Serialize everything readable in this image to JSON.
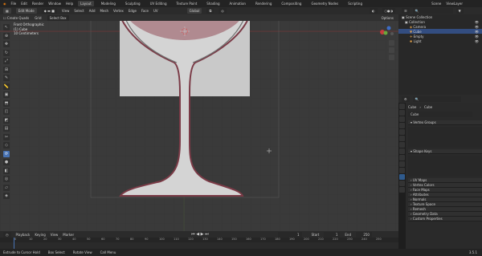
{
  "menu": {
    "items": [
      "File",
      "Edit",
      "Render",
      "Window",
      "Help"
    ]
  },
  "workspaces": [
    "Layout",
    "Modeling",
    "Sculpting",
    "UV Editing",
    "Texture Paint",
    "Shading",
    "Animation",
    "Rendering",
    "Compositing",
    "Geometry Nodes",
    "Scripting"
  ],
  "active_workspace": "Layout",
  "scene_name": "Scene",
  "view_layer": "ViewLayer",
  "viewport_header": {
    "mode": "Edit Mode",
    "menus": [
      "View",
      "Select",
      "Add",
      "Mesh",
      "Vertex",
      "Edge",
      "Face",
      "UV"
    ],
    "transform_orientation": "Global"
  },
  "tool_settings": {
    "create_quads": "Create Quads",
    "grid_fill_label": "Grid",
    "select_box": "Select Box"
  },
  "options_label": "Options",
  "overlay": {
    "view": "Front Orthographic",
    "object": "(1) Cube",
    "scale": "10 Centimeters"
  },
  "timeline": {
    "menus": [
      "Playback",
      "Keying",
      "View",
      "Marker"
    ],
    "ticks": [
      "0",
      "10",
      "20",
      "30",
      "40",
      "50",
      "60",
      "70",
      "80",
      "90",
      "100",
      "110",
      "120",
      "130",
      "140",
      "150",
      "160",
      "170",
      "180",
      "190",
      "200",
      "210",
      "220",
      "230",
      "240",
      "250"
    ],
    "current_frame": "1",
    "start_label": "Start",
    "start": "1",
    "end_label": "End",
    "end": "250"
  },
  "status": {
    "left": "Extrude to Cursor Hold",
    "middle": "Box Select",
    "right": "Rotate View",
    "mode": "Call Menu",
    "version": "3.5.1"
  },
  "outliner": {
    "rows": [
      {
        "label": "Scene Collection",
        "selected": false,
        "indent": 0
      },
      {
        "label": "Collection",
        "selected": false,
        "indent": 1
      },
      {
        "label": "Camera",
        "selected": false,
        "indent": 2
      },
      {
        "label": "Cube",
        "selected": true,
        "indent": 2
      },
      {
        "label": "Empty",
        "selected": false,
        "indent": 2
      },
      {
        "label": "Light",
        "selected": false,
        "indent": 2
      }
    ]
  },
  "properties": {
    "breadcrumb_object": "Cube",
    "breadcrumb_data": "Cube",
    "data_name": "Cube",
    "panels": [
      "Vertex Groups",
      "Shape Keys",
      "UV Maps",
      "Vertex Colors",
      "Face Maps",
      "Attributes",
      "Normals",
      "Texture Space",
      "Remesh",
      "Geometry Data",
      "Custom Properties"
    ]
  },
  "colors": {
    "accent": "#4772b3",
    "selected_row": "#334d80",
    "mesh_edge": "#7a3a46",
    "mesh_fill": "#c8c8c8"
  }
}
